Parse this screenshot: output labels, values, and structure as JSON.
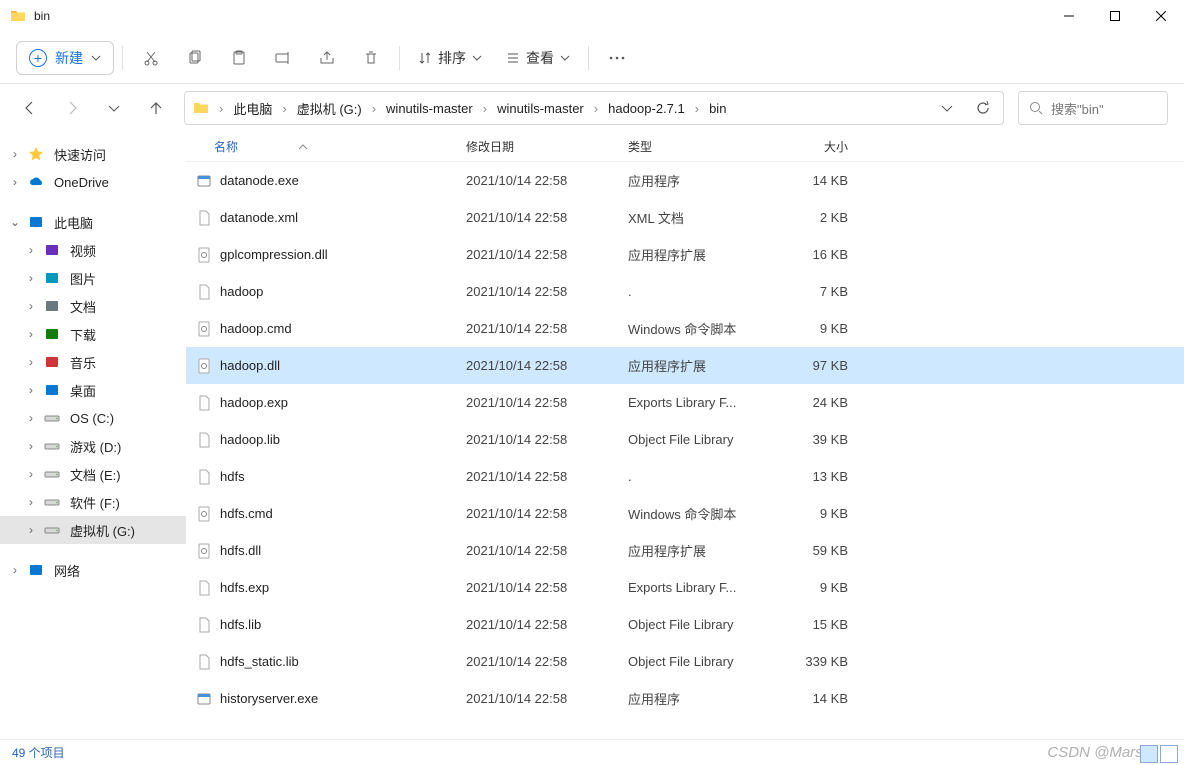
{
  "window": {
    "title": "bin"
  },
  "toolbar": {
    "new_label": "新建",
    "sort_label": "排序",
    "view_label": "查看"
  },
  "breadcrumb": {
    "segments": [
      "此电脑",
      "虚拟机 (G:)",
      "winutils-master",
      "winutils-master",
      "hadoop-2.7.1",
      "bin"
    ]
  },
  "search": {
    "placeholder": "搜索\"bin\""
  },
  "sidebar": {
    "items": [
      {
        "label": "快速访问",
        "icon": "star",
        "expanded": false,
        "indent": 0
      },
      {
        "label": "OneDrive",
        "icon": "onedrive",
        "expanded": false,
        "indent": 0
      },
      {
        "spacer": true
      },
      {
        "label": "此电脑",
        "icon": "pc",
        "expanded": true,
        "indent": 0
      },
      {
        "label": "视频",
        "icon": "video",
        "expanded": false,
        "indent": 1
      },
      {
        "label": "图片",
        "icon": "pictures",
        "expanded": false,
        "indent": 1
      },
      {
        "label": "文档",
        "icon": "docs",
        "expanded": false,
        "indent": 1
      },
      {
        "label": "下载",
        "icon": "downloads",
        "expanded": false,
        "indent": 1
      },
      {
        "label": "音乐",
        "icon": "music",
        "expanded": false,
        "indent": 1
      },
      {
        "label": "桌面",
        "icon": "desktop",
        "expanded": false,
        "indent": 1
      },
      {
        "label": "OS (C:)",
        "icon": "drive",
        "expanded": false,
        "indent": 1
      },
      {
        "label": "游戏 (D:)",
        "icon": "drive",
        "expanded": false,
        "indent": 1
      },
      {
        "label": "文档 (E:)",
        "icon": "drive",
        "expanded": false,
        "indent": 1
      },
      {
        "label": "软件 (F:)",
        "icon": "drive",
        "expanded": false,
        "indent": 1
      },
      {
        "label": "虚拟机 (G:)",
        "icon": "drive",
        "expanded": false,
        "indent": 1,
        "selected": true
      },
      {
        "spacer": true
      },
      {
        "label": "网络",
        "icon": "network",
        "expanded": false,
        "indent": 0
      }
    ]
  },
  "columns": {
    "name": "名称",
    "date": "修改日期",
    "type": "类型",
    "size": "大小"
  },
  "files": [
    {
      "name": "datanode.exe",
      "date": "2021/10/14 22:58",
      "type": "应用程序",
      "size": "14 KB",
      "icon": "exe"
    },
    {
      "name": "datanode.xml",
      "date": "2021/10/14 22:58",
      "type": "XML 文档",
      "size": "2 KB",
      "icon": "file"
    },
    {
      "name": "gplcompression.dll",
      "date": "2021/10/14 22:58",
      "type": "应用程序扩展",
      "size": "16 KB",
      "icon": "dll"
    },
    {
      "name": "hadoop",
      "date": "2021/10/14 22:58",
      "type": ".",
      "size": "7 KB",
      "icon": "file"
    },
    {
      "name": "hadoop.cmd",
      "date": "2021/10/14 22:58",
      "type": "Windows 命令脚本",
      "size": "9 KB",
      "icon": "cmd"
    },
    {
      "name": "hadoop.dll",
      "date": "2021/10/14 22:58",
      "type": "应用程序扩展",
      "size": "97 KB",
      "icon": "dll",
      "selected": true
    },
    {
      "name": "hadoop.exp",
      "date": "2021/10/14 22:58",
      "type": "Exports Library F...",
      "size": "24 KB",
      "icon": "file"
    },
    {
      "name": "hadoop.lib",
      "date": "2021/10/14 22:58",
      "type": "Object File Library",
      "size": "39 KB",
      "icon": "file"
    },
    {
      "name": "hdfs",
      "date": "2021/10/14 22:58",
      "type": ".",
      "size": "13 KB",
      "icon": "file"
    },
    {
      "name": "hdfs.cmd",
      "date": "2021/10/14 22:58",
      "type": "Windows 命令脚本",
      "size": "9 KB",
      "icon": "cmd"
    },
    {
      "name": "hdfs.dll",
      "date": "2021/10/14 22:58",
      "type": "应用程序扩展",
      "size": "59 KB",
      "icon": "dll"
    },
    {
      "name": "hdfs.exp",
      "date": "2021/10/14 22:58",
      "type": "Exports Library F...",
      "size": "9 KB",
      "icon": "file"
    },
    {
      "name": "hdfs.lib",
      "date": "2021/10/14 22:58",
      "type": "Object File Library",
      "size": "15 KB",
      "icon": "file"
    },
    {
      "name": "hdfs_static.lib",
      "date": "2021/10/14 22:58",
      "type": "Object File Library",
      "size": "339 KB",
      "icon": "file"
    },
    {
      "name": "historyserver.exe",
      "date": "2021/10/14 22:58",
      "type": "应用程序",
      "size": "14 KB",
      "icon": "exe"
    }
  ],
  "status": {
    "count": "49 个项目",
    "watermark": "CSDN @Marsor"
  }
}
